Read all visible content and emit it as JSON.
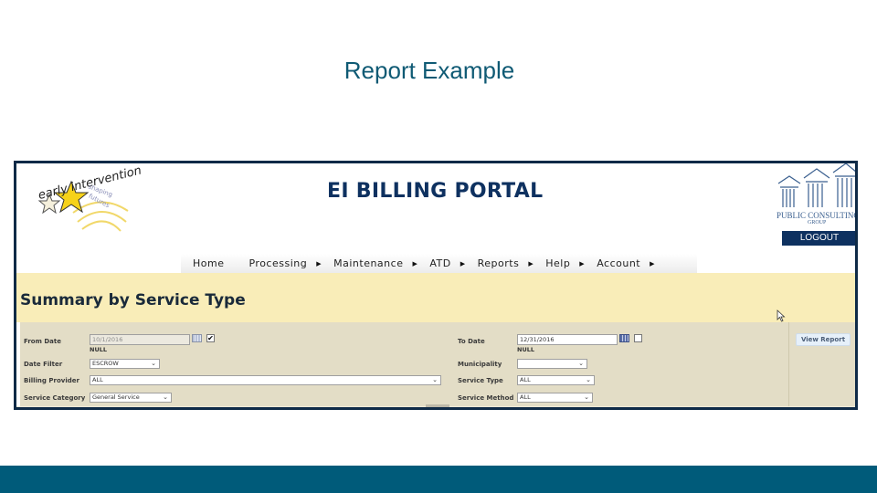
{
  "slide": {
    "title": "Report Example",
    "accent_color": "#005b7a",
    "frame_color": "#0e2a47"
  },
  "portal": {
    "logo": {
      "brand_text": "early intervention",
      "tagline_line1": "shaping",
      "tagline_line2": "futures"
    },
    "title": "EI BILLING PORTAL",
    "partner_logo": {
      "name": "PUBLIC CONSULTING",
      "sub": "GROUP"
    },
    "logout_label": "LOGOUT"
  },
  "nav": {
    "items": [
      {
        "label": "Home",
        "has_submenu": false
      },
      {
        "label": "Processing",
        "has_submenu": true
      },
      {
        "label": "Maintenance",
        "has_submenu": true
      },
      {
        "label": "ATD",
        "has_submenu": true
      },
      {
        "label": "Reports",
        "has_submenu": true
      },
      {
        "label": "Help",
        "has_submenu": true
      },
      {
        "label": "Account",
        "has_submenu": true
      }
    ],
    "submenu_glyph": "▶"
  },
  "page": {
    "heading": "Summary by Service Type"
  },
  "params": {
    "from_date": {
      "label": "From Date",
      "value": "10/1/2016",
      "null_label": "NULL",
      "null_checked": true,
      "disabled": true
    },
    "to_date": {
      "label": "To Date",
      "value": "12/31/2016",
      "null_label": "NULL",
      "null_checked": false,
      "disabled": false
    },
    "date_filter": {
      "label": "Date Filter",
      "value": "ESCROW"
    },
    "municipality": {
      "label": "Municipality",
      "value": ""
    },
    "billing_provider": {
      "label": "Billing Provider",
      "value": "ALL"
    },
    "service_type": {
      "label": "Service Type",
      "value": "ALL"
    },
    "service_category": {
      "label": "Service Category",
      "value": "General Service"
    },
    "service_method": {
      "label": "Service Method",
      "value": "ALL"
    },
    "check_glyph": "✔",
    "chevron_glyph": "⌄",
    "view_report_label": "View Report"
  }
}
